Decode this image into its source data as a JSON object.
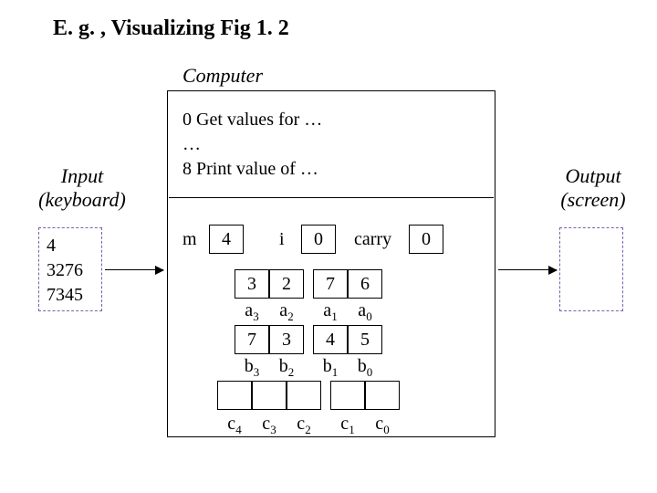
{
  "title": "E. g. , Visualizing Fig 1. 2",
  "computer_label": "Computer",
  "input_label_1": "Input",
  "input_label_2": "(keyboard)",
  "output_label_1": "Output",
  "output_label_2": "(screen)",
  "input_values": [
    "4",
    "3276",
    "7345"
  ],
  "program": {
    "line0": "0  Get values for …",
    "line1": "…",
    "line2": "8  Print value of …"
  },
  "m_label": "m",
  "m_value": "4",
  "i_label": "i",
  "i_value": "0",
  "carry_label": "carry",
  "carry_value": "0",
  "a_row": [
    "3",
    "2",
    "7",
    "6"
  ],
  "a_labels": [
    "a",
    "a",
    "a",
    "a"
  ],
  "a_subs": [
    "3",
    "2",
    "1",
    "0"
  ],
  "b_row": [
    "7",
    "3",
    "4",
    "5"
  ],
  "b_labels": [
    "b",
    "b",
    "b",
    "b"
  ],
  "b_subs": [
    "3",
    "2",
    "1",
    "0"
  ],
  "c_labels": [
    "c",
    "c",
    "c",
    "c",
    "c"
  ],
  "c_subs": [
    "4",
    "3",
    "2",
    "1",
    "0"
  ]
}
